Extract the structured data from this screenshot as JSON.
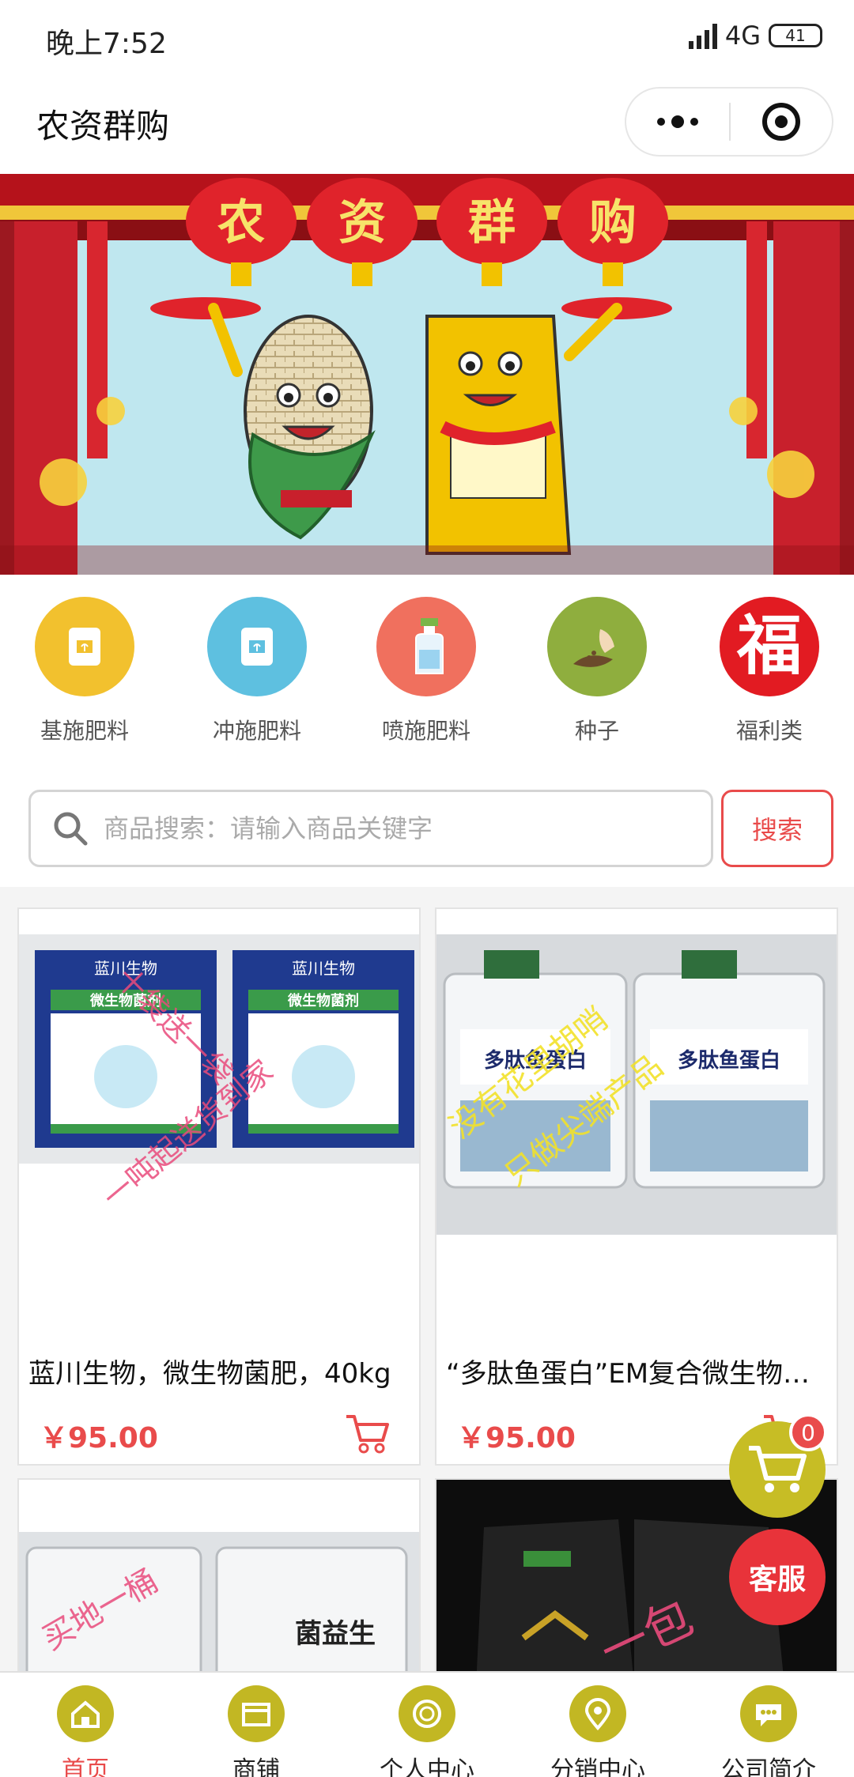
{
  "status_bar": {
    "time": "晚上7:52",
    "network": "4G",
    "battery": "41"
  },
  "header": {
    "title": "农资群购",
    "more_icon": "more-dots-icon",
    "close_icon": "target-close-icon"
  },
  "banner": {
    "lantern_chars": [
      "农",
      "资",
      "群",
      "购"
    ],
    "colors": {
      "red": "#c8202c",
      "gold": "#f2c200",
      "sky": "#bfe7ef"
    }
  },
  "categories": [
    {
      "label": "基施肥料",
      "icon": "fertilizer-bag-icon",
      "color": "#f2c12e"
    },
    {
      "label": "冲施肥料",
      "icon": "fertilizer-bag-icon",
      "color": "#5ec0e0"
    },
    {
      "label": "喷施肥料",
      "icon": "spray-bottle-icon",
      "color": "#f0705e"
    },
    {
      "label": "种子",
      "icon": "seed-hand-icon",
      "color": "#8fae3e"
    },
    {
      "label": "福利类",
      "icon": "fu-character-icon",
      "color": "#e21b22",
      "glyph": "福"
    }
  ],
  "search": {
    "placeholder": "商品搜索：请输入商品关键字",
    "button": "搜索"
  },
  "products": [
    {
      "name": "蓝川生物，微生物菌肥，40kg",
      "price": "￥95.00",
      "overlay_lines": [
        "十袋送一袋",
        "一吨起送货到家"
      ],
      "package_title": "微生物菌剂",
      "brand_text": "蓝川生物"
    },
    {
      "name": "“多肽鱼蛋白”EM复合微生物菌剂",
      "price": "￥95.00",
      "overlay_lines": [
        "没有花里胡哨",
        "只做尖端产品"
      ],
      "package_title": "多肽鱼蛋白"
    },
    {
      "name": "",
      "price": "",
      "overlay_lines": [
        "买地一桶"
      ],
      "package_title": "菌益生"
    },
    {
      "name": "",
      "price": "",
      "overlay_lines": [
        "一包"
      ]
    }
  ],
  "floating": {
    "cart_count": "0",
    "service_label": "客服"
  },
  "tabbar": [
    {
      "label": "首页",
      "icon": "home-icon",
      "active": true
    },
    {
      "label": "商铺",
      "icon": "shop-icon",
      "active": false
    },
    {
      "label": "个人中心",
      "icon": "user-center-icon",
      "active": false
    },
    {
      "label": "分销中心",
      "icon": "location-pin-icon",
      "active": false
    },
    {
      "label": "公司简介",
      "icon": "chat-bubble-icon",
      "active": false
    }
  ],
  "theme": {
    "accent_red": "#e94b4b",
    "tab_icon_olive": "#c2b723"
  }
}
